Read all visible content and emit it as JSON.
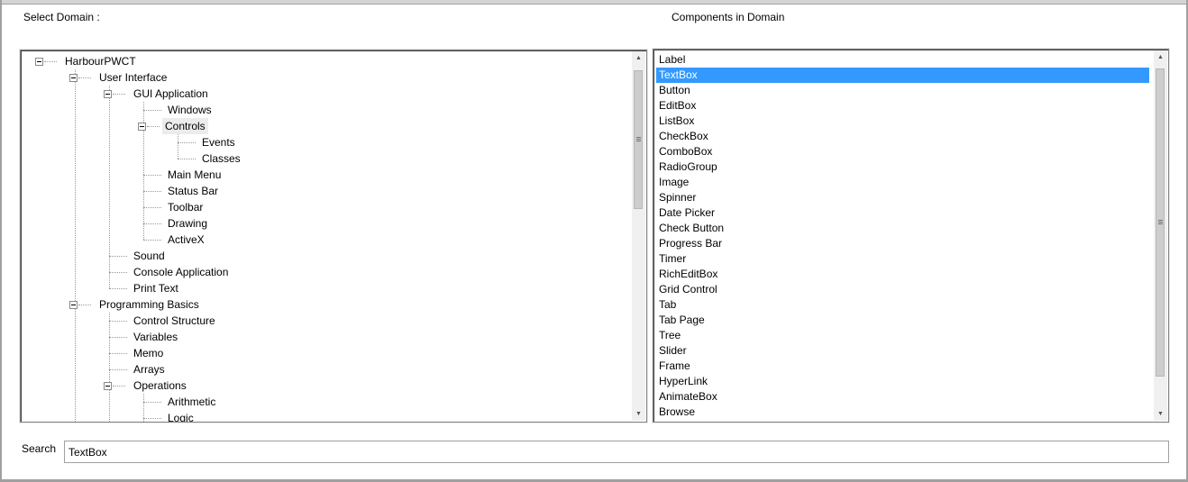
{
  "labels": {
    "select_domain": "Select Domain :",
    "components_in_domain": "Components in Domain",
    "search": "Search"
  },
  "tree": {
    "nodes": [
      "HarbourPWCT",
      "User Interface",
      "GUI Application",
      "Windows",
      "Controls",
      "Events",
      "Classes",
      "Main Menu",
      "Status Bar",
      "Toolbar",
      "Drawing",
      "ActiveX",
      "Sound",
      "Console Application",
      "Print Text",
      "Programming Basics",
      "Control Structure",
      "Variables",
      "Memo",
      "Arrays",
      "Operations",
      "Arithmetic",
      "Logic"
    ],
    "selected": "Controls"
  },
  "components": {
    "items": [
      "Label",
      "TextBox",
      "Button",
      "EditBox",
      "ListBox",
      "CheckBox",
      "ComboBox",
      "RadioGroup",
      "Image",
      "Spinner",
      "Date Picker",
      "Check Button",
      "Progress Bar",
      "Timer",
      "RichEditBox",
      "Grid Control",
      "Tab",
      "Tab Page",
      "Tree",
      "Slider",
      "Frame",
      "HyperLink",
      "AnimateBox",
      "Browse"
    ],
    "selected": "TextBox"
  },
  "search": {
    "value": "TextBox"
  },
  "icons": {
    "expander": "minus-box-icon",
    "scroll_up": "arrow-up-icon",
    "scroll_down": "arrow-down-icon"
  }
}
